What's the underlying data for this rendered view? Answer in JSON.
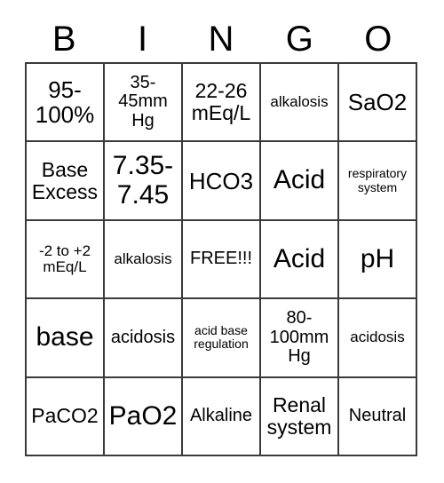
{
  "card": {
    "title": "BINGO card",
    "headers": [
      "B",
      "I",
      "N",
      "G",
      "O"
    ],
    "rows": [
      [
        {
          "text": "95-100%",
          "size": "fs-xl"
        },
        {
          "text": "35-45mm Hg",
          "size": "fs-md"
        },
        {
          "text": "22-26 mEq/L",
          "size": "fs-lg"
        },
        {
          "text": "alkalosis",
          "size": "fs-sm"
        },
        {
          "text": "SaO2",
          "size": "fs-xl"
        }
      ],
      [
        {
          "text": "Base Excess",
          "size": "fs-lg"
        },
        {
          "text": "7.35-7.45",
          "size": "fs-xxl"
        },
        {
          "text": "HCO3",
          "size": "fs-xl"
        },
        {
          "text": "Acid",
          "size": "fs-xxl"
        },
        {
          "text": "respiratory system",
          "size": "fs-xs"
        }
      ],
      [
        {
          "text": "-2 to +2 mEq/L",
          "size": "fs-sm"
        },
        {
          "text": "alkalosis",
          "size": "fs-sm"
        },
        {
          "text": "FREE!!!",
          "size": "fs-md"
        },
        {
          "text": "Acid",
          "size": "fs-xxl"
        },
        {
          "text": "pH",
          "size": "fs-xxl"
        }
      ],
      [
        {
          "text": "base",
          "size": "fs-xxl"
        },
        {
          "text": "acidosis",
          "size": "fs-md"
        },
        {
          "text": "acid base regulation",
          "size": "fs-xs"
        },
        {
          "text": "80-100mm Hg",
          "size": "fs-md"
        },
        {
          "text": "acidosis",
          "size": "fs-sm"
        }
      ],
      [
        {
          "text": "PaCO2",
          "size": "fs-lg"
        },
        {
          "text": "PaO2",
          "size": "fs-xxl"
        },
        {
          "text": "Alkaline",
          "size": "fs-md"
        },
        {
          "text": "Renal system",
          "size": "fs-lg"
        },
        {
          "text": "Neutral",
          "size": "fs-md"
        }
      ]
    ],
    "colors": {
      "border": "#3a3a3a",
      "cell_background": "#ffffff",
      "text": "#000000"
    }
  }
}
